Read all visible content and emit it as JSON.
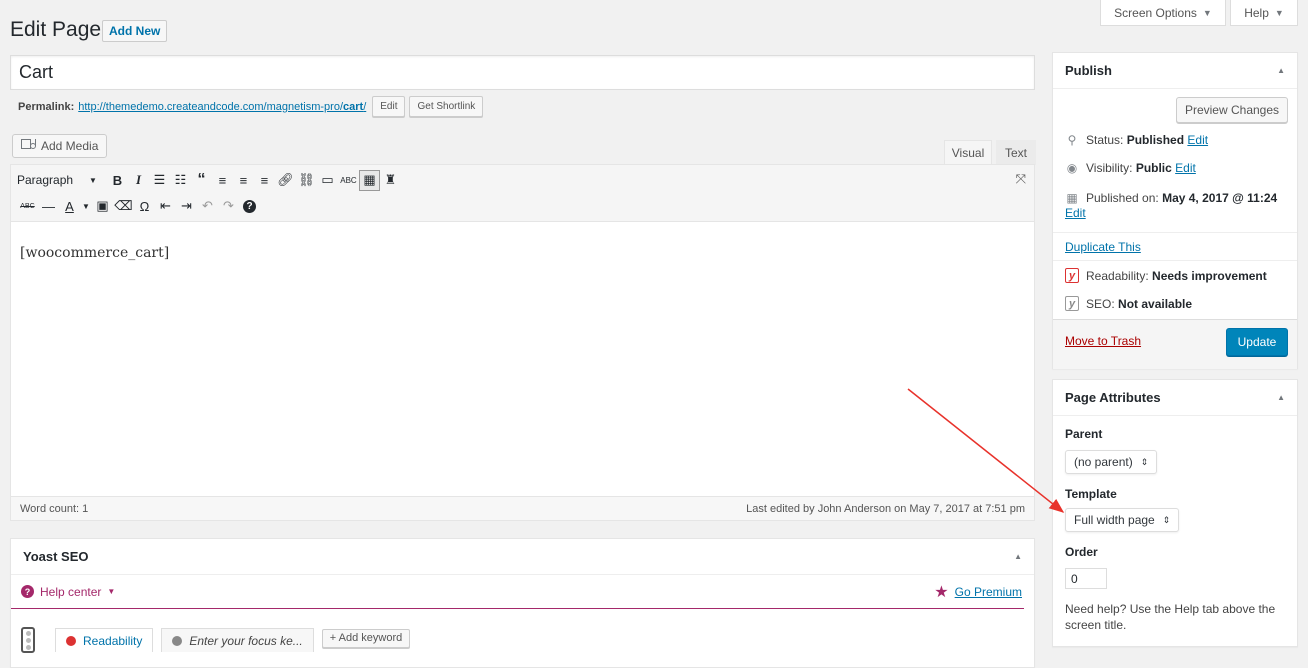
{
  "header": {
    "page_title": "Edit Page",
    "add_new_label": "Add New",
    "screen_options_label": "Screen Options",
    "help_label": "Help"
  },
  "post": {
    "title": "Cart",
    "permalink_label": "Permalink:",
    "permalink_base": "http://themedemo.createandcode.com/magnetism-pro/",
    "permalink_slug": "cart",
    "permalink_trailing": "/",
    "edit_permalink_label": "Edit",
    "get_shortlink_label": "Get Shortlink",
    "content": "[woocommerce_cart]"
  },
  "editor": {
    "add_media_label": "Add Media",
    "tabs": [
      {
        "label": "Visual",
        "active": true
      },
      {
        "label": "Text",
        "active": false
      }
    ],
    "format_select": "Paragraph",
    "toolbar_row1": [
      "bold-icon",
      "italic-icon",
      "bulleted-list-icon",
      "numbered-list-icon",
      "blockquote-icon",
      "align-left-icon",
      "align-center-icon",
      "align-right-icon",
      "insert-link-icon",
      "remove-link-icon",
      "read-more-icon",
      "spellcheck-icon",
      "toolbar-toggle-icon",
      "incognito-icon"
    ],
    "toolbar_row2": [
      "strikethrough-icon",
      "horizontal-line-icon",
      "text-color-icon",
      "paste-as-text-icon",
      "clear-formatting-icon",
      "special-character-icon",
      "decrease-indent-icon",
      "increase-indent-icon",
      "undo-icon",
      "redo-icon",
      "keyboard-shortcuts-icon"
    ],
    "word_count_label": "Word count: 1",
    "last_edited": "Last edited by John Anderson on May 7, 2017 at 7:51 pm"
  },
  "yoast": {
    "title": "Yoast SEO",
    "help_center_label": "Help center",
    "go_premium_label": "Go Premium",
    "readability_tab": "Readability",
    "focus_keyword_tab": "Enter your focus ke...",
    "add_keyword_label": "+ Add keyword"
  },
  "publish": {
    "title": "Publish",
    "preview_label": "Preview Changes",
    "status_label": "Status:",
    "status_value": "Published",
    "visibility_label": "Visibility:",
    "visibility_value": "Public",
    "published_on_label": "Published on:",
    "published_on_value": "May 4, 2017 @ 11:24",
    "edit_label": "Edit",
    "duplicate_label": "Duplicate This",
    "readability_label": "Readability:",
    "readability_value": "Needs improvement",
    "seo_label": "SEO:",
    "seo_value": "Not available",
    "trash_label": "Move to Trash",
    "update_label": "Update"
  },
  "page_attributes": {
    "title": "Page Attributes",
    "parent_label": "Parent",
    "parent_value": "(no parent)",
    "template_label": "Template",
    "template_value": "Full width page",
    "order_label": "Order",
    "order_value": "0",
    "help_text": "Need help? Use the Help tab above the screen title."
  },
  "colors": {
    "link": "#0073aa",
    "primary_button": "#0085ba",
    "trash_link": "#a00",
    "yoast_accent": "#a4286a",
    "annotation_arrow": "#e8322b"
  }
}
